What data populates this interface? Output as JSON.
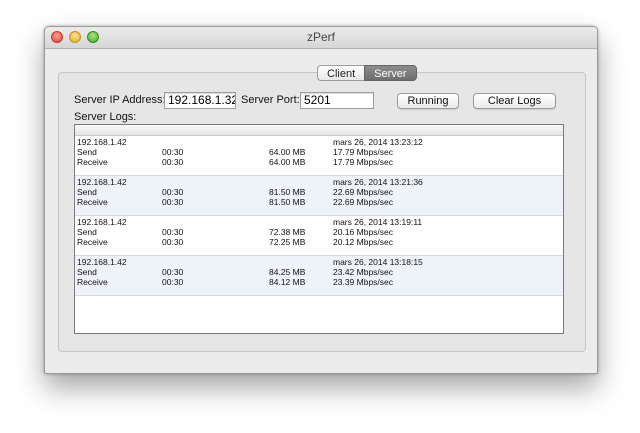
{
  "window": {
    "title": "zPerf"
  },
  "tabs": [
    {
      "label": "Client",
      "selected": false
    },
    {
      "label": "Server",
      "selected": true
    }
  ],
  "form": {
    "ip_label": "Server IP Address:",
    "ip_value": "192.168.1.32",
    "port_label": "Server Port:",
    "port_value": "5201",
    "running_label": "Running",
    "clear_label": "Clear Logs",
    "logs_label": "Server Logs:"
  },
  "logs": [
    {
      "ip": "192.168.1.42",
      "date": "mars 26, 2014 13:23:12",
      "send": {
        "label": "Send",
        "time": "00:30",
        "size": "64.00 MB",
        "rate": "17.79 Mbps/sec"
      },
      "recv": {
        "label": "Receive",
        "time": "00:30",
        "size": "64.00 MB",
        "rate": "17.79 Mbps/sec"
      }
    },
    {
      "ip": "192.168.1.42",
      "date": "mars 26, 2014 13:21:36",
      "send": {
        "label": "Send",
        "time": "00:30",
        "size": "81.50 MB",
        "rate": "22.69 Mbps/sec"
      },
      "recv": {
        "label": "Receive",
        "time": "00:30",
        "size": "81.50 MB",
        "rate": "22.69 Mbps/sec"
      }
    },
    {
      "ip": "192.168.1.42",
      "date": "mars 26, 2014 13:19:11",
      "send": {
        "label": "Send",
        "time": "00:30",
        "size": "72.38 MB",
        "rate": "20.16 Mbps/sec"
      },
      "recv": {
        "label": "Receive",
        "time": "00:30",
        "size": "72.25 MB",
        "rate": "20.12 Mbps/sec"
      }
    },
    {
      "ip": "192.168.1.42",
      "date": "mars 26, 2014 13:18:15",
      "send": {
        "label": "Send",
        "time": "00:30",
        "size": "84.25 MB",
        "rate": "23.42 Mbps/sec"
      },
      "recv": {
        "label": "Receive",
        "time": "00:30",
        "size": "84.12 MB",
        "rate": "23.39 Mbps/sec"
      }
    }
  ]
}
